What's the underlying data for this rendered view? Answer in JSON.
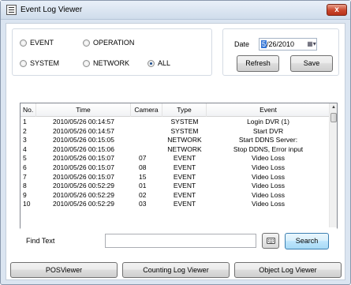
{
  "window": {
    "title": "Event Log Viewer",
    "close_label": "x"
  },
  "filters": {
    "options": [
      {
        "label": "EVENT",
        "checked": false
      },
      {
        "label": "OPERATION",
        "checked": false
      },
      {
        "label": "SYSTEM",
        "checked": false
      },
      {
        "label": "NETWORK",
        "checked": false
      },
      {
        "label": "ALL",
        "checked": true
      }
    ]
  },
  "date": {
    "label": "Date",
    "value_selected": "5",
    "value_rest": "/26/2010"
  },
  "buttons": {
    "refresh": "Refresh",
    "save": "Save",
    "search": "Search",
    "pos_viewer": "POSViewer",
    "counting_log": "Counting Log Viewer",
    "object_log": "Object Log Viewer"
  },
  "table": {
    "columns": [
      "No.",
      "Time",
      "Camera",
      "Type",
      "Event"
    ],
    "rows": [
      [
        "1",
        "2010/05/26 00:14:57",
        "",
        "SYSTEM",
        "Login DVR (1)"
      ],
      [
        "2",
        "2010/05/26 00:14:57",
        "",
        "SYSTEM",
        "Start DVR"
      ],
      [
        "3",
        "2010/05/26 00:15:05",
        "",
        "NETWORK",
        "Start DDNS Server:"
      ],
      [
        "4",
        "2010/05/26 00:15:06",
        "",
        "NETWORK",
        "Stop DDNS, Error input"
      ],
      [
        "5",
        "2010/05/26 00:15:07",
        "07",
        "EVENT",
        "Video Loss"
      ],
      [
        "6",
        "2010/05/26 00:15:07",
        "08",
        "EVENT",
        "Video Loss"
      ],
      [
        "7",
        "2010/05/26 00:15:07",
        "15",
        "EVENT",
        "Video Loss"
      ],
      [
        "8",
        "2010/05/26 00:52:29",
        "01",
        "EVENT",
        "Video Loss"
      ],
      [
        "9",
        "2010/05/26 00:52:29",
        "02",
        "EVENT",
        "Video Loss"
      ],
      [
        "10",
        "2010/05/26 00:52:29",
        "03",
        "EVENT",
        "Video Loss"
      ]
    ]
  },
  "find": {
    "label": "Find Text",
    "value": ""
  },
  "icons": {
    "app": "list-icon",
    "keyboard": "keyboard-icon",
    "calendar": "calendar-dropdown-icon"
  }
}
